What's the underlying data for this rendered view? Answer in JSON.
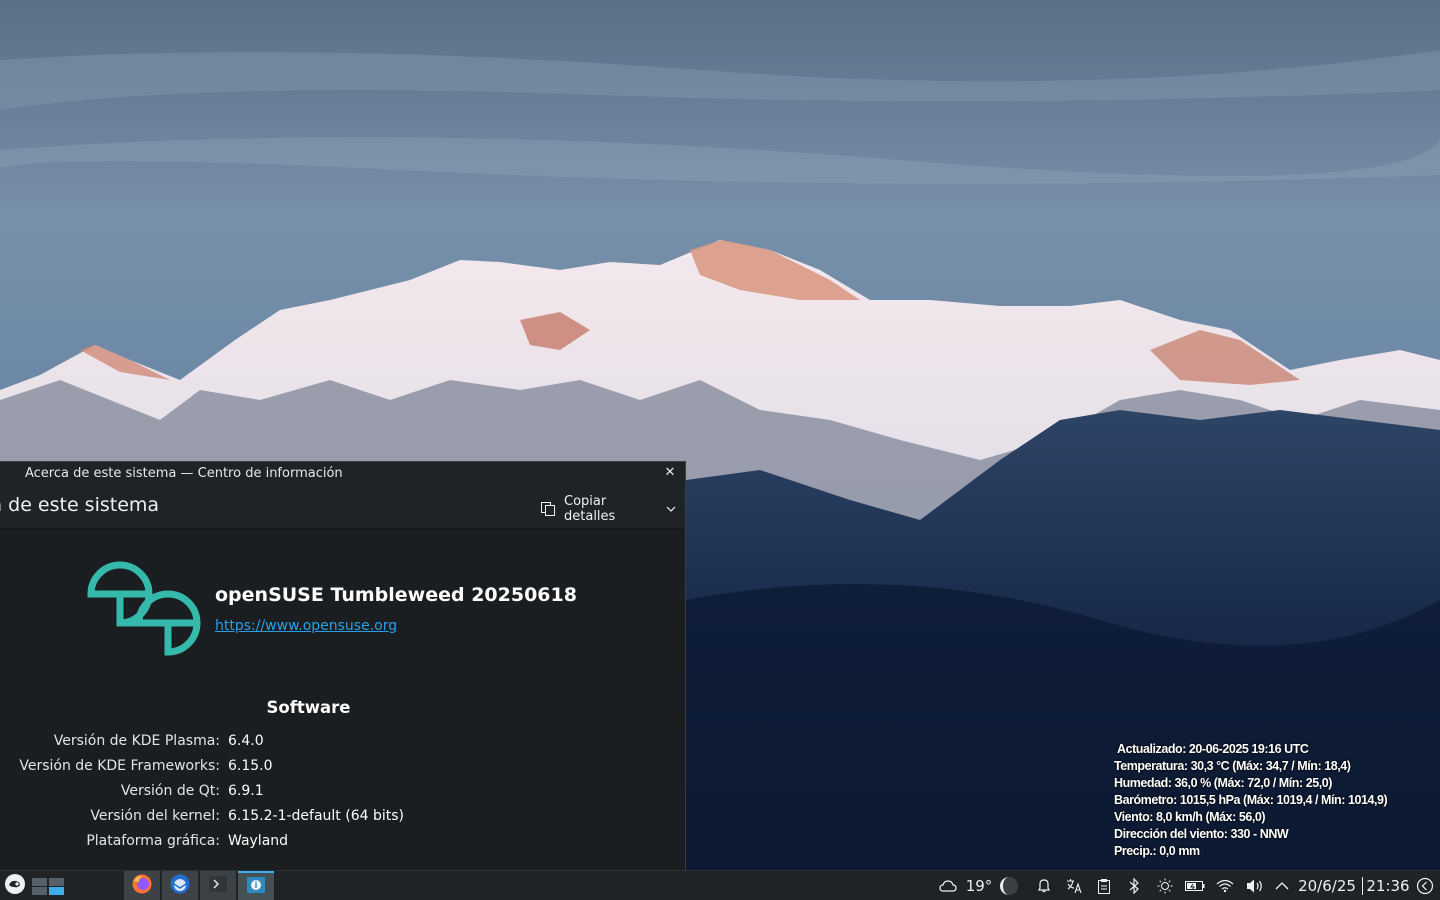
{
  "window": {
    "title": "Acerca de este sistema — Centro de información",
    "page_heading": "ca de este sistema",
    "copy_button_label": "Copiar detalles"
  },
  "about": {
    "distro_name": "openSUSE Tumbleweed 20250618",
    "distro_url": "https://www.opensuse.org",
    "software_heading": "Software",
    "rows": [
      {
        "label": "Versión de KDE Plasma:",
        "value": "6.4.0"
      },
      {
        "label": "Versión de KDE Frameworks:",
        "value": "6.15.0"
      },
      {
        "label": "Versión de Qt:",
        "value": "6.9.1"
      },
      {
        "label": "Versión del kernel:",
        "value": "6.15.2-1-default (64 bits)"
      },
      {
        "label": "Plataforma gráfica:",
        "value": "Wayland"
      }
    ]
  },
  "weather_widget": {
    "lines": [
      "Actualizado: 20-06-2025 19:16 UTC",
      "Temperatura: 30,3 °C (Máx: 34,7  / Mín: 18,4)",
      "Humedad: 36,0 % (Máx: 72,0 / Mín: 25,0)",
      "Barómetro: 1015,5 hPa (Máx: 1019,4 / Mín: 1014,9)",
      "Viento: 8,0 km/h (Máx: 56,0)",
      "Dirección del viento: 330 - NNW",
      "Precip.: 0,0 mm"
    ]
  },
  "panel": {
    "temperature": "19°",
    "date": "20/6/25",
    "time": "21:36",
    "taskbar_icons": [
      "firefox-icon",
      "thunderbird-icon",
      "konsole-icon",
      "info-center-icon"
    ],
    "tray_icons": [
      "weather-cloud-icon",
      "moon-icon",
      "notifications-icon",
      "translate-icon",
      "clipboard-icon",
      "bluetooth-icon",
      "brightness-icon",
      "battery-icon",
      "wifi-icon",
      "volume-icon",
      "show-hidden-icon"
    ]
  },
  "colors": {
    "window_bg": "#202326",
    "content_bg": "#1b1e20",
    "link": "#2a9fe8",
    "opensuse_green": "#35b9ab",
    "accent": "#3daee9"
  }
}
